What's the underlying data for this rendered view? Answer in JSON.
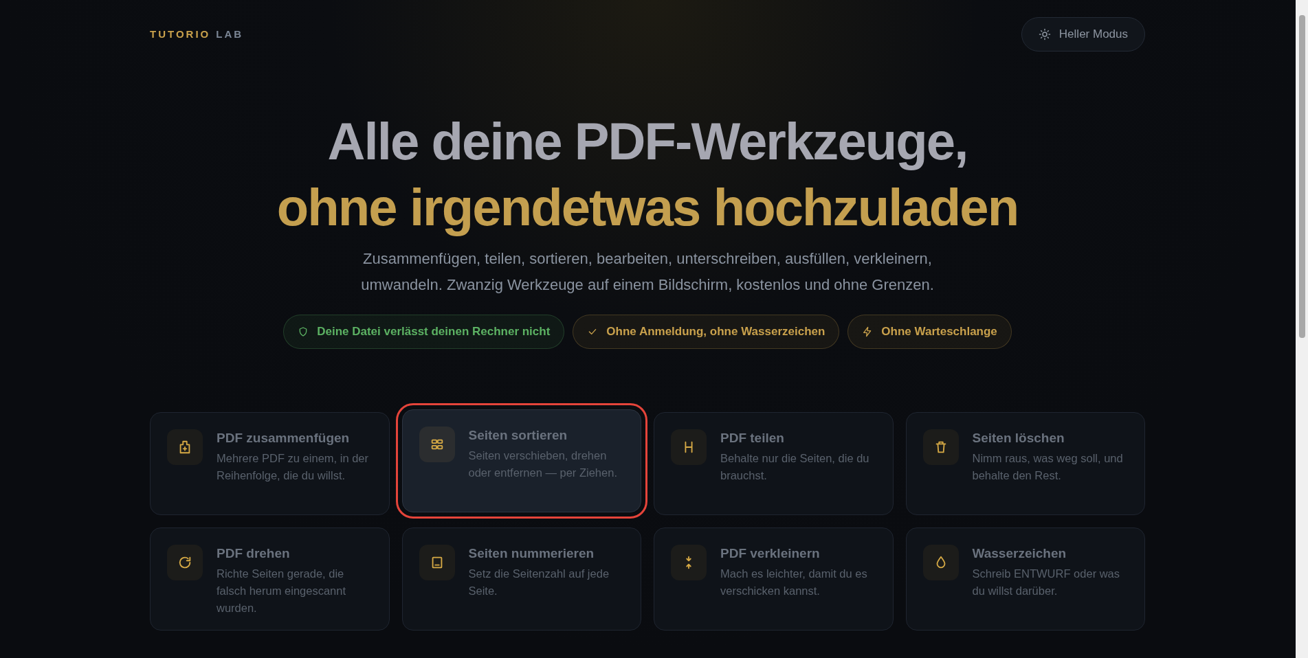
{
  "header": {
    "logo": {
      "primary": "TUTORIO",
      "secondary": "LAB"
    },
    "theme_button": {
      "label": "Heller Modus"
    }
  },
  "hero": {
    "title_line_1": "Alle deine PDF-Werkzeuge,",
    "title_line_2": "ohne irgendetwas hochzuladen",
    "subtitle": "Zusammenfügen, teilen, sortieren, bearbeiten, unterschreiben, ausfüllen, verkleinern, umwandeln. Zwanzig Werkzeuge auf einem Bildschirm, kostenlos und ohne Grenzen."
  },
  "badges": [
    {
      "label": "Deine Datei verlässt deinen Rechner nicht",
      "color": "#5cb263"
    },
    {
      "label": "Ohne Anmeldung, ohne Wasserzeichen",
      "color": "#c9a14c"
    },
    {
      "label": "Ohne Warteschlange",
      "color": "#c9a14c"
    }
  ],
  "tools": [
    {
      "title": "PDF zusammenfügen",
      "description": "Mehrere PDF zu einem, in der Reihenfolge, die du willst.",
      "selected": false
    },
    {
      "title": "Seiten sortieren",
      "description": "Seiten verschieben, drehen oder entfernen — per Ziehen.",
      "selected": true
    },
    {
      "title": "PDF teilen",
      "description": "Behalte nur die Seiten, die du brauchst.",
      "selected": false
    },
    {
      "title": "Seiten löschen",
      "description": "Nimm raus, was weg soll, und behalte den Rest.",
      "selected": false
    },
    {
      "title": "PDF drehen",
      "description": "Richte Seiten gerade, die falsch herum eingescannt wurden.",
      "selected": false
    },
    {
      "title": "Seiten nummerieren",
      "description": "Setz die Seitenzahl auf jede Seite.",
      "selected": false
    },
    {
      "title": "PDF verkleinern",
      "description": "Mach es leichter, damit du es verschicken kannst.",
      "selected": false
    },
    {
      "title": "Wasserzeichen",
      "description": "Schreib ENTWURF oder was du willst darüber.",
      "selected": false
    }
  ]
}
